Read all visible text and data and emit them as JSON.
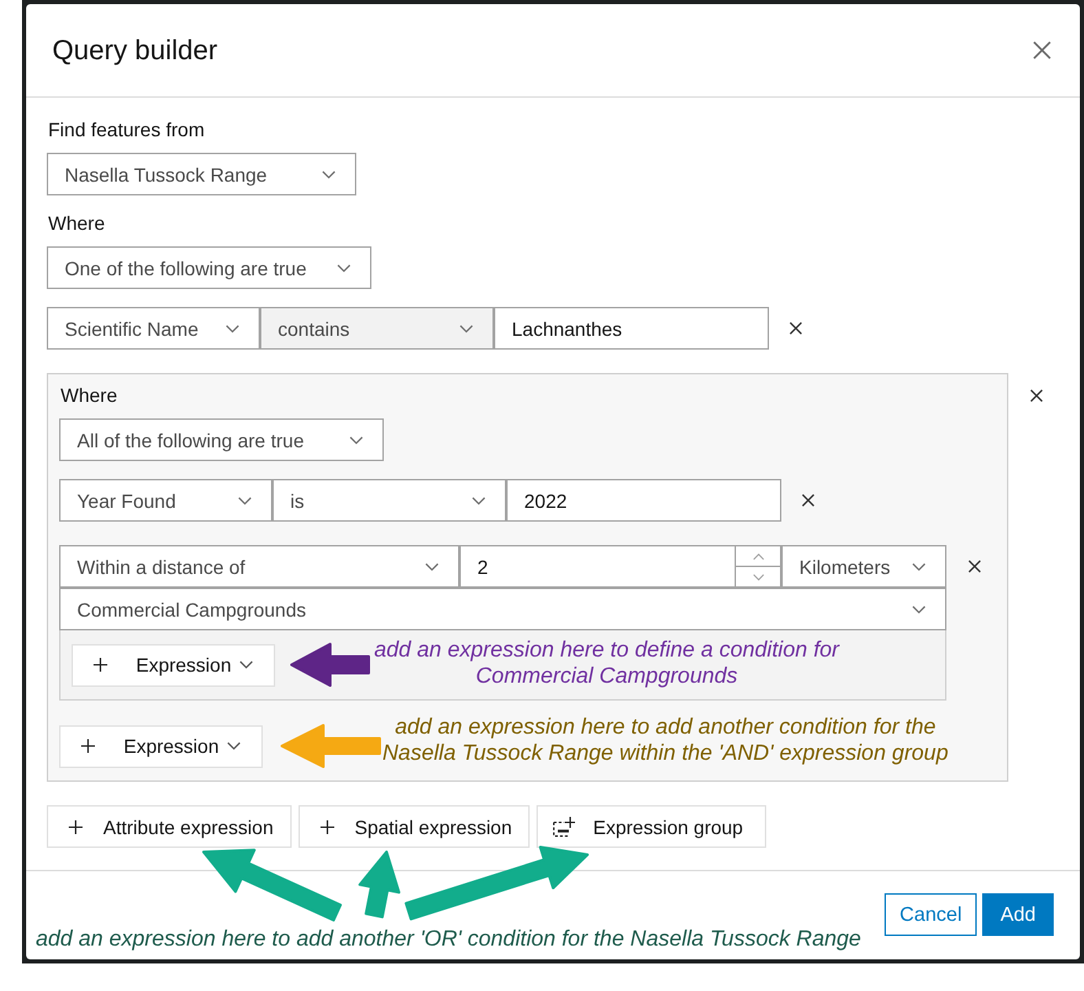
{
  "window": {
    "title": "Query builder"
  },
  "source": {
    "label": "Find features from",
    "layer": "Nasella Tussock Range"
  },
  "where": {
    "label": "Where",
    "match": "One of the following are true"
  },
  "expressions": [
    {
      "kind": "attribute",
      "field": "Scientific Name",
      "operator": "contains",
      "operator_highlighted": true,
      "value": "Lachnanthes"
    },
    {
      "kind": "group",
      "label": "Where",
      "match": "All of the following are true",
      "expressions": [
        {
          "kind": "attribute",
          "field": "Year Found",
          "operator": "is",
          "operator_highlighted": false,
          "value": "2022"
        },
        {
          "kind": "spatial",
          "relation": "Within a distance of",
          "distance": "2",
          "unit": "Kilometers",
          "layer": "Commercial Campgrounds",
          "add_button": "Expression",
          "annotation": {
            "arrow": {
              "color": "#5e2587"
            },
            "text": {
              "lines": [
                "add an expression here to define a condition for",
                "Commercial Campgrounds"
              ],
              "color": "#7030a0"
            }
          }
        }
      ],
      "add_button": "Expression",
      "annotation": {
        "arrow": {
          "color": "#f5a913"
        },
        "text": {
          "lines": [
            "add an expression here to add another condition for the",
            "Nasella Tussock Range within the 'AND' expression group"
          ],
          "color": "#7f6000"
        }
      }
    }
  ],
  "add_buttons": [
    {
      "kind": "plus",
      "label": "Attribute expression"
    },
    {
      "kind": "plus",
      "label": "Spatial expression"
    },
    {
      "kind": "group",
      "label": "Expression group"
    }
  ],
  "footer": {
    "annotation": {
      "arrow": {
        "color": "#12ad8c"
      },
      "text": {
        "lines": [
          "add an expression here to add another 'OR' condition for the Nasella Tussock Range"
        ],
        "color": "#1e5b4c"
      }
    },
    "buttons": [
      {
        "kind": "secondary",
        "label": "Cancel"
      },
      {
        "kind": "primary",
        "label": "Add"
      }
    ]
  }
}
